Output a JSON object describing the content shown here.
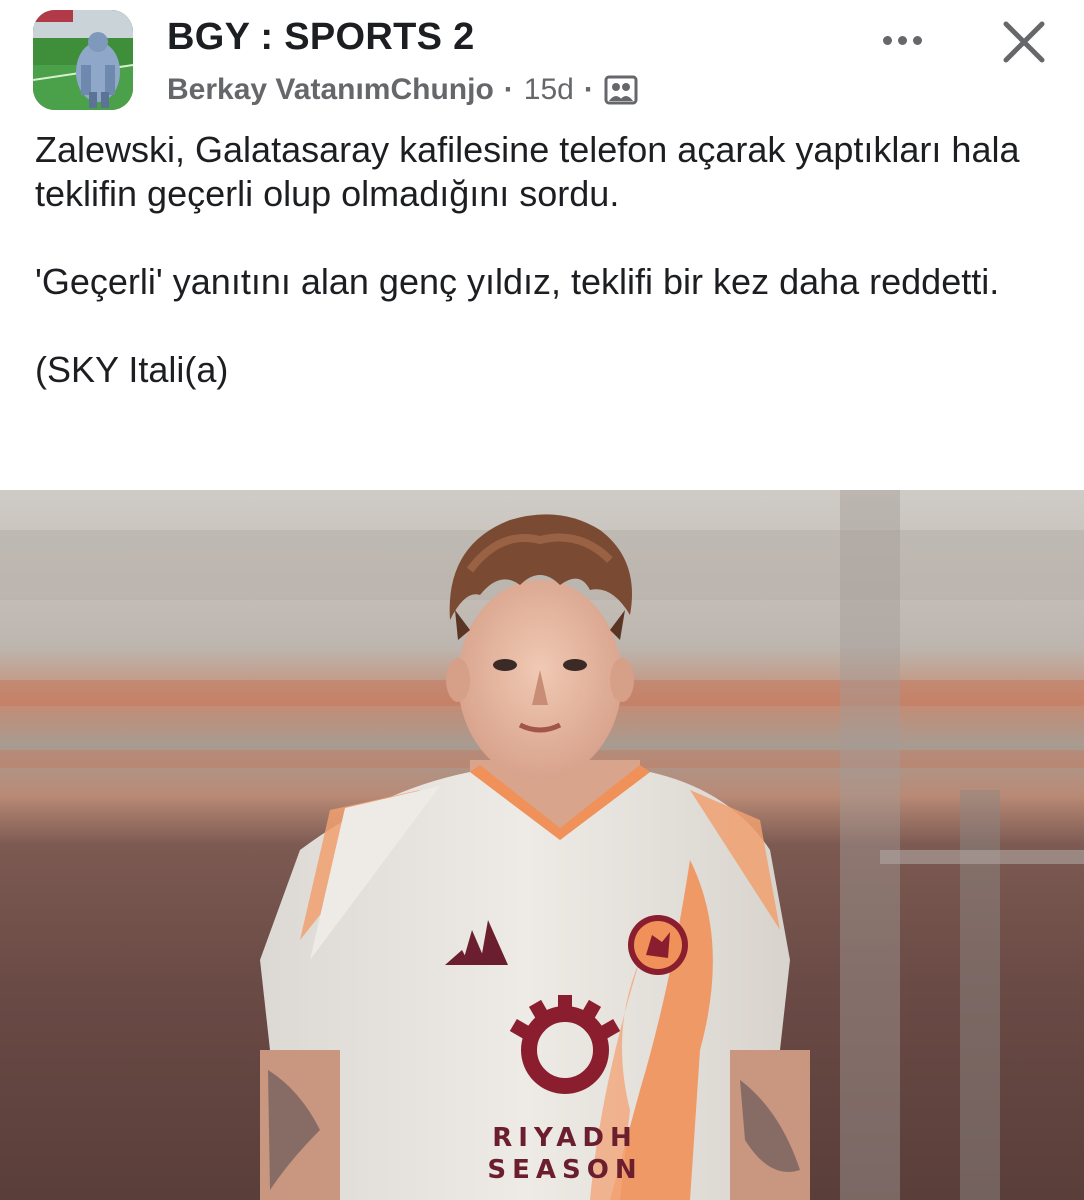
{
  "post": {
    "group_name": "BGY : SPORTS 2",
    "author": "Berkay VatanımChunjo",
    "time": "15d",
    "separator": "·",
    "paragraphs": [
      "Zalewski, Galatasaray kafilesine telefon açarak yaptıkları hala teklifin geçerli olup olmadığını sordu.",
      "'Geçerli' yanıtını alan genç yıldız, teklifi bir kez daha reddetti.",
      "(SKY Itali(a)"
    ]
  },
  "header": {
    "more_icon": "more-options-icon",
    "close_icon": "close-icon",
    "audience_icon": "group-members-icon"
  },
  "photo": {
    "sponsor_line1": "RIYADH",
    "sponsor_line2": "SEASON"
  },
  "colors": {
    "meta_text": "#65676b",
    "kit_white": "#ece8e3",
    "kit_orange": "#f0915a",
    "roma_maroon": "#8b1e2e"
  }
}
